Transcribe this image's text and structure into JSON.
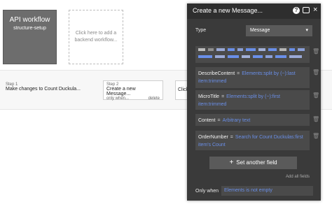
{
  "workflow_card": {
    "title": "API workflow",
    "subtitle": "structure-setup"
  },
  "placeholder_card": {
    "text": "Click here to add a backend workflow..."
  },
  "steps": [
    {
      "label": "Step 1",
      "text": "Make changes to Count Duckula..."
    },
    {
      "label": "Step 2",
      "text": "Create a new Message...",
      "only_when": "only when...",
      "delete": "delete"
    },
    {
      "text": "Click"
    }
  ],
  "panel": {
    "title": "Create a new Message...",
    "icons": {
      "help": "help-icon",
      "chat": "comment-icon",
      "close": "close-icon"
    },
    "help_glyph": "?",
    "close_glyph": "×",
    "type_label": "Type",
    "type_value": "Message",
    "fields": [
      {
        "name": "DescribeContent",
        "eq": "=",
        "expr": "Elements:split by (~):last item:trimmed"
      },
      {
        "name": "MicroTitle",
        "eq": "=",
        "expr": "Elements:split by (~):first item:trimmed"
      },
      {
        "name": "Content",
        "eq": "=",
        "expr": "Arbitrary text"
      },
      {
        "name": "OrderNumber",
        "eq": "=",
        "expr": "Search for Count Duckulas:first item's Count"
      }
    ],
    "set_another_field": "Set another field",
    "add_all_fields": "Add all fields",
    "only_when_label": "Only when",
    "only_when_value": "Elements is not empty"
  },
  "colors": {
    "panel_bg": "#3a3a3a",
    "expression_blue": "#6a8fe8"
  }
}
